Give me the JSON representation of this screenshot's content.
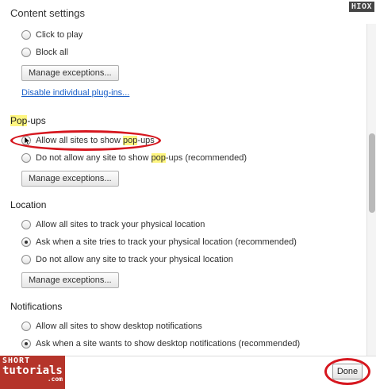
{
  "dialog": {
    "title": "Content settings",
    "watermark": "HIOX"
  },
  "plugins": {
    "options": [
      {
        "label": "Click to play",
        "selected": false
      },
      {
        "label": "Block all",
        "selected": false
      }
    ],
    "manage_label": "Manage exceptions...",
    "disable_link": "Disable individual plug-ins..."
  },
  "popups": {
    "title_part1": "Pop",
    "title_part2": "-ups",
    "allow_part1": "Allow all sites to show ",
    "allow_part2": "pop",
    "allow_part3": "-ups",
    "block_part1": "Do not allow any site to show ",
    "block_part2": "pop",
    "block_part3": "-ups (recommended)",
    "manage_label": "Manage exceptions..."
  },
  "location": {
    "title": "Location",
    "options": [
      {
        "label": "Allow all sites to track your physical location",
        "selected": false
      },
      {
        "label": "Ask when a site tries to track your physical location (recommended)",
        "selected": true
      },
      {
        "label": "Do not allow any site to track your physical location",
        "selected": false
      }
    ],
    "manage_label": "Manage exceptions..."
  },
  "notifications": {
    "title": "Notifications",
    "options": [
      {
        "label": "Allow all sites to show desktop notifications",
        "selected": false
      },
      {
        "label": "Ask when a site wants to show desktop notifications (recommended)",
        "selected": true
      }
    ]
  },
  "footer": {
    "done_label": "Done"
  },
  "brand": {
    "line1": "SHORT",
    "line2": "tutorials",
    "line3": ".com"
  },
  "colors": {
    "annotation": "#d6171f",
    "highlight": "#fff680",
    "link": "#1a5fc8",
    "brand": "#b5342a"
  }
}
